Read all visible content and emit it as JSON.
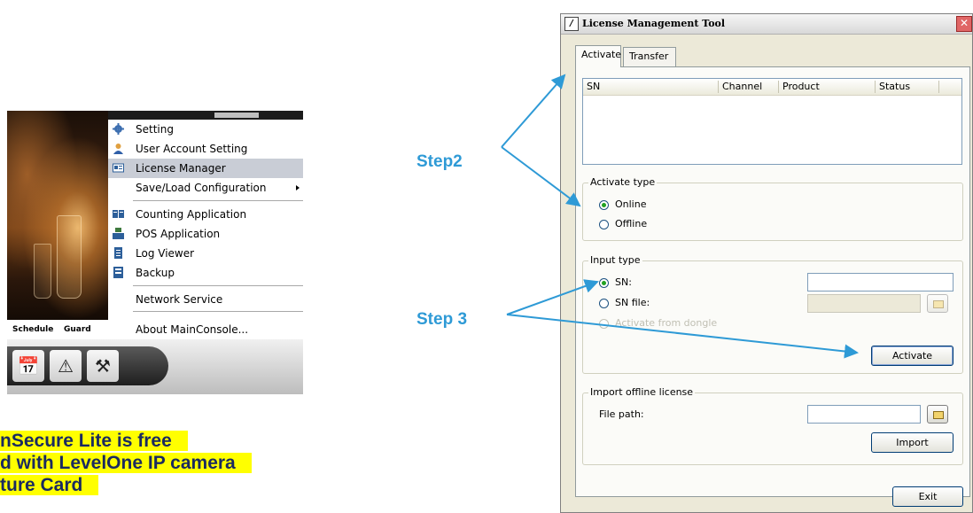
{
  "context_menu": {
    "items": [
      {
        "label": "Setting",
        "icon": "gear-icon"
      },
      {
        "label": "User Account Setting",
        "icon": "user-icon"
      },
      {
        "label": "License Manager",
        "icon": "license-icon"
      },
      {
        "label": "Save/Load Configuration",
        "icon": ""
      },
      {
        "label": "Counting Application",
        "icon": "counting-icon"
      },
      {
        "label": "POS Application",
        "icon": "pos-icon"
      },
      {
        "label": "Log Viewer",
        "icon": "log-icon"
      },
      {
        "label": "Backup",
        "icon": "backup-icon"
      },
      {
        "label": "Network Service",
        "icon": ""
      },
      {
        "label": "About MainConsole...",
        "icon": ""
      }
    ],
    "highlighted": "License Manager"
  },
  "bottom_tabs": {
    "schedule": "Schedule",
    "guard": "Guard"
  },
  "note": {
    "line1": "nSecure Lite is free",
    "line2": "d with LevelOne IP camera",
    "line3": "ture Card"
  },
  "steps": {
    "step2": "Step2",
    "step3": "Step 3"
  },
  "window": {
    "title": "License Management Tool",
    "tabs": {
      "activate": "Activate",
      "transfer": "Transfer"
    },
    "table_columns": {
      "sn": "SN",
      "channel": "Channel",
      "product": "Product",
      "status": "Status"
    },
    "activate_type": {
      "legend": "Activate type",
      "online": "Online",
      "offline": "Offline",
      "selected": "Online"
    },
    "input_type": {
      "legend": "Input type",
      "sn": "SN:",
      "sn_file": "SN file:",
      "dongle": "Activate from dongle",
      "activate_button": "Activate"
    },
    "import_offline": {
      "legend": "Import offline license",
      "file_path": "File path:",
      "import_button": "Import"
    },
    "exit_button": "Exit"
  },
  "colors": {
    "arrow": "#2e9ad6",
    "highlight": "#ffff00",
    "note_text": "#1a2a60"
  }
}
